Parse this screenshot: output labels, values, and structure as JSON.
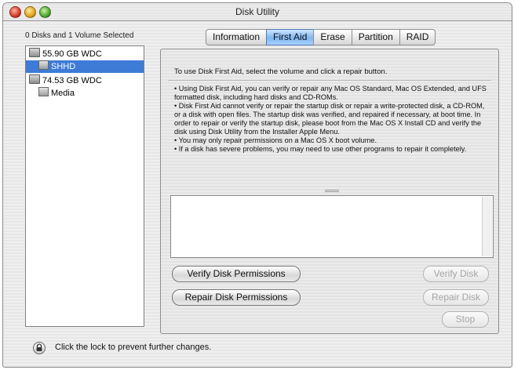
{
  "window": {
    "title": "Disk Utility"
  },
  "sidebar": {
    "header": "0 Disks and 1 Volume Selected",
    "items": [
      {
        "label": "55.90 GB WDC",
        "kind": "disk",
        "selected": false
      },
      {
        "label": "SHHD",
        "kind": "volume",
        "selected": true
      },
      {
        "label": "74.53 GB WDC",
        "kind": "disk",
        "selected": false
      },
      {
        "label": "Media",
        "kind": "volume",
        "selected": false
      }
    ]
  },
  "tabs": [
    {
      "label": "Information",
      "active": false
    },
    {
      "label": "First Aid",
      "active": true
    },
    {
      "label": "Erase",
      "active": false
    },
    {
      "label": "Partition",
      "active": false
    },
    {
      "label": "RAID",
      "active": false
    }
  ],
  "first_aid": {
    "intro": "To use Disk First Aid, select the volume and click a repair button.",
    "bullets": [
      "• Using Disk First Aid, you can verify or repair any Mac OS Standard, Mac OS Extended, and UFS formatted disk, including hard disks and CD-ROMs.",
      "• Disk First Aid cannot verify or repair the startup disk or repair a write-protected disk, a CD-ROM, or a disk with open files.  The startup disk was verified, and repaired if necessary, at boot time.  In order to repair or verify the startup disk, please boot from the Mac OS X Install CD and verify the disk using Disk Utility from the Installer Apple Menu.",
      "• You may only repair permissions on a Mac OS X boot volume.",
      "• If a disk has severe problems, you may need to use other programs to repair it completely."
    ],
    "log_text": ""
  },
  "buttons": {
    "verify_permissions": "Verify Disk Permissions",
    "repair_permissions": "Repair Disk Permissions",
    "verify_disk": "Verify Disk",
    "repair_disk": "Repair Disk",
    "stop": "Stop"
  },
  "footer": {
    "lock_text": "Click the lock to prevent further changes."
  },
  "colors": {
    "selection": "#3d7bd7",
    "active_tab": "#7eb6f4"
  }
}
